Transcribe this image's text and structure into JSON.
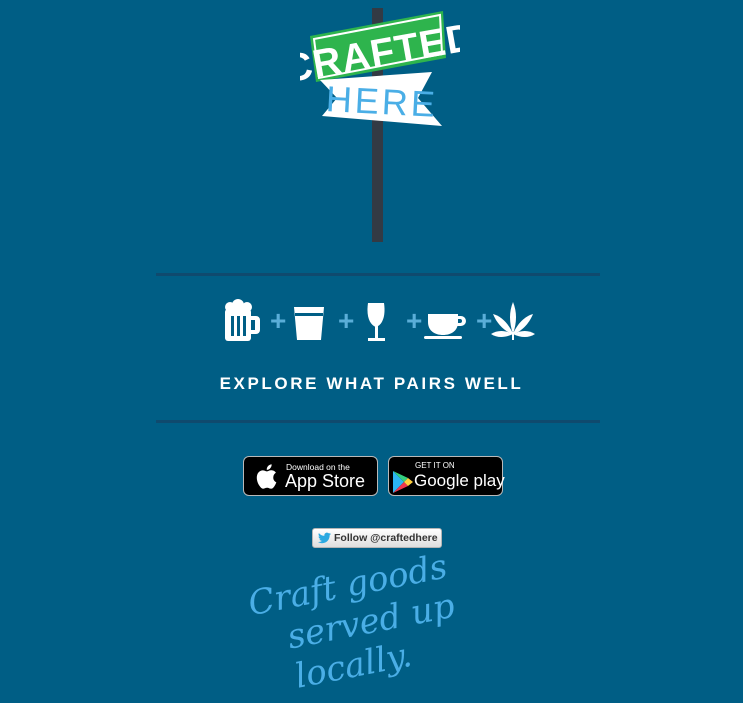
{
  "logo": {
    "line1": "CRAFTED",
    "line2": "HERE"
  },
  "pairing": {
    "items": [
      "beer-icon",
      "pint-glass-icon",
      "wine-glass-icon",
      "coffee-cup-icon",
      "cannabis-leaf-icon"
    ],
    "separator": "+"
  },
  "tagline": "EXPLORE WHAT PAIRS WELL",
  "app_store": {
    "small": "Download on the",
    "big": "App Store"
  },
  "google_play": {
    "small": "GET IT ON",
    "big": "Google play"
  },
  "twitter": {
    "label": "Follow @craftedhere"
  },
  "slogan": {
    "line1": "Craft goods",
    "line2": "served up locally."
  },
  "colors": {
    "background": "#005e85",
    "green": "#2eb44d",
    "light_blue": "#4aaee6",
    "pole": "#333a44",
    "divider": "#0f4a6e"
  }
}
